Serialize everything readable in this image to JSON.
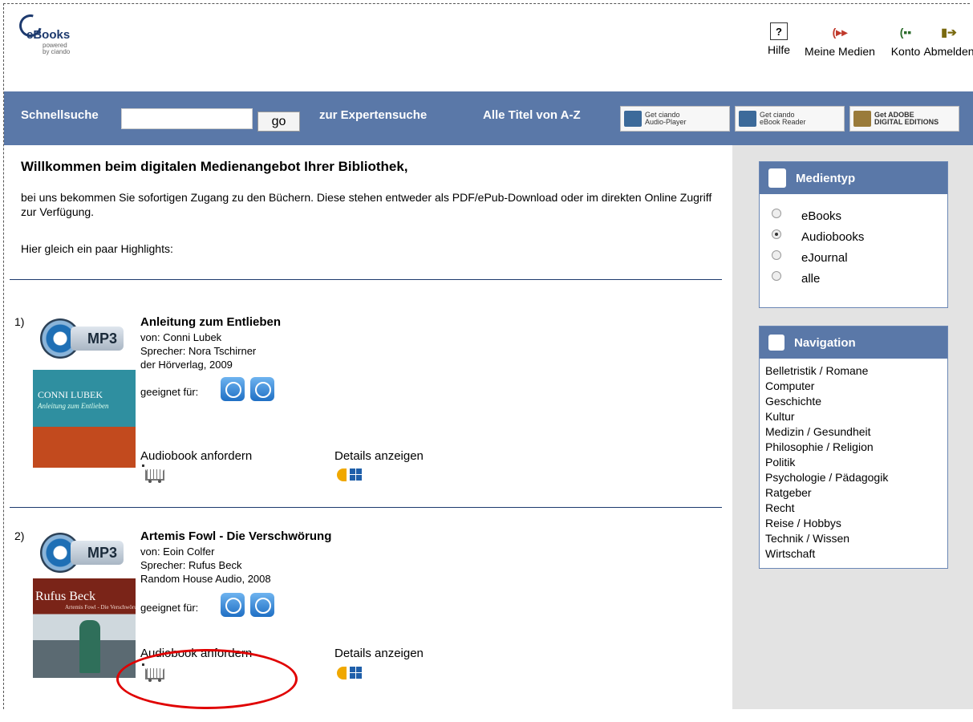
{
  "header": {
    "logo": {
      "name": "eBooks",
      "tagline_1": "powered",
      "tagline_2": "by ciando"
    },
    "top_icons": [
      {
        "label": "Hilfe",
        "icon": "help-icon"
      },
      {
        "label": "Meine Medien",
        "icon": "my-media-icon"
      },
      {
        "label": "Konto",
        "icon": "account-icon"
      },
      {
        "label": "Abmelden",
        "icon": "logout-icon"
      }
    ]
  },
  "searchbar": {
    "label": "Schnellsuche",
    "input_value": "",
    "go_label": "go",
    "expert_search": "zur Expertensuche",
    "all_titles": "Alle Titel von A-Z",
    "badges": [
      {
        "line1": "Get ciando",
        "line2": "Audio-Player"
      },
      {
        "line1": "Get ciando",
        "line2": "eBook Reader"
      },
      {
        "line1": "Get ADOBE",
        "line2": "DIGITAL EDITIONS"
      }
    ]
  },
  "main": {
    "welcome": "Willkommen beim digitalen Medienangebot Ihrer Bibliothek,",
    "intro": "bei uns bekommen Sie sofortigen Zugang zu den Büchern. Diese stehen entweder als PDF/ePub-Download oder im direkten Online Zugriff zur Verfügung.",
    "highlights": "Hier gleich ein paar Highlights:",
    "items": [
      {
        "number": "1)",
        "format": "MP3",
        "title": "Anleitung zum Entlieben",
        "author": "von: Conni Lubek",
        "speaker": "Sprecher: Nora Tschirner",
        "publisher": "der Hörverlag, 2009",
        "suitable": "geeignet für:",
        "request": "Audiobook anfordern",
        "details": "Details anzeigen",
        "cover_line1": "CONNI LUBEK",
        "cover_line2": "Anleitung zum Entlieben"
      },
      {
        "number": "2)",
        "format": "MP3",
        "title": "Artemis Fowl - Die Verschwörung",
        "author": "von: Eoin Colfer",
        "speaker": "Sprecher: Rufus Beck",
        "publisher": "Random House Audio, 2008",
        "suitable": "geeignet für:",
        "request": "Audiobook anfordern",
        "details": "Details anzeigen",
        "cover_line1": "Rufus Beck",
        "cover_line2": "Artemis Fowl - Die Verschwörung"
      }
    ]
  },
  "sidebar": {
    "media_type": {
      "title": "Medientyp",
      "options": [
        "eBooks",
        "Audiobooks",
        "eJournal",
        "alle"
      ],
      "selected": "Audiobooks"
    },
    "navigation": {
      "title": "Navigation",
      "items": [
        "Belletristik / Romane",
        "Computer",
        "Geschichte",
        "Kultur",
        "Medizin / Gesundheit",
        "Philosophie / Religion",
        "Politik",
        "Psychologie / Pädagogik",
        "Ratgeber",
        "Recht",
        "Reise / Hobbys",
        "Technik / Wissen",
        "Wirtschaft"
      ]
    }
  },
  "colors": {
    "bar": "#5a78a8",
    "sidebar_bg": "#e3e3e3",
    "rule": "#1d3a6e",
    "highlight": "#e00000"
  }
}
